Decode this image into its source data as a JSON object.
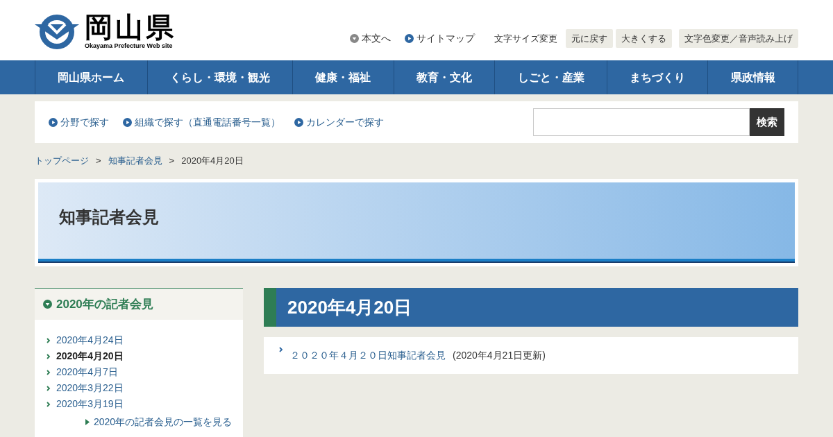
{
  "header": {
    "logo_title": "岡山県",
    "logo_subtitle": "Okayama Prefecture Web site",
    "links": [
      {
        "kind": "down",
        "label": "本文へ"
      },
      {
        "kind": "right",
        "label": "サイトマップ"
      }
    ],
    "font_size_label": "文字サイズ変更",
    "buttons": [
      "元に戻す",
      "大きくする",
      "文字色変更／音声読み上げ"
    ]
  },
  "nav": [
    "岡山県ホーム",
    "くらし・環境・観光",
    "健康・福祉",
    "教育・文化",
    "しごと・産業",
    "まちづくり",
    "県政情報"
  ],
  "search_bar": {
    "links": [
      "分野で探す",
      "組織で探す（直通電話番号一覧）",
      "カレンダーで探す"
    ],
    "button": "検索"
  },
  "breadcrumb_separator": ">",
  "breadcrumb": [
    {
      "label": "トップページ",
      "link": true
    },
    {
      "label": "知事記者会見",
      "link": true
    },
    {
      "label": "2020年4月20日",
      "link": false
    }
  ],
  "banner_title": "知事記者会見",
  "sidebar": {
    "title": "2020年の記者会見",
    "items": [
      {
        "label": "2020年4月24日",
        "selected": false
      },
      {
        "label": "2020年4月20日",
        "selected": true
      },
      {
        "label": "2020年4月7日",
        "selected": false
      },
      {
        "label": "2020年3月22日",
        "selected": false
      },
      {
        "label": "2020年3月19日",
        "selected": false
      }
    ],
    "more": "2020年の記者会見の一覧を見る"
  },
  "main": {
    "title": "2020年4月20日",
    "entries": [
      {
        "link": "２０２０年４月２０日知事記者会見",
        "updated": "(2020年4月21日更新)"
      }
    ]
  }
}
